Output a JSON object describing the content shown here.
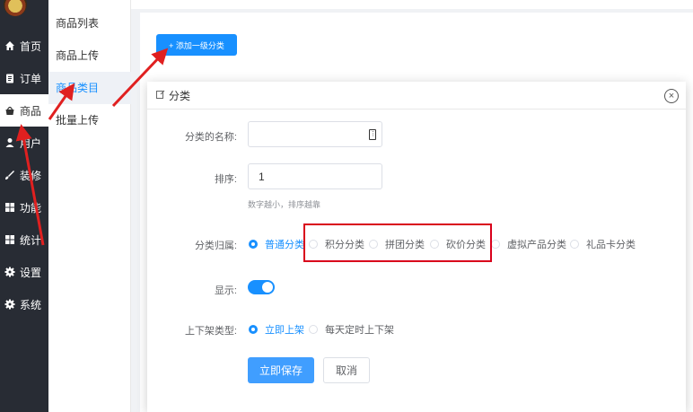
{
  "sidebar": {
    "items": [
      {
        "label": "首页",
        "icon": "home-icon"
      },
      {
        "label": "订单",
        "icon": "clipboard-icon"
      },
      {
        "label": "商品",
        "icon": "bag-icon",
        "active": true
      },
      {
        "label": "用户",
        "icon": "user-icon"
      },
      {
        "label": "装修",
        "icon": "brush-icon"
      },
      {
        "label": "功能",
        "icon": "grid-icon"
      },
      {
        "label": "统计",
        "icon": "chart-grid-icon"
      },
      {
        "label": "设置",
        "icon": "gear-icon"
      },
      {
        "label": "系统",
        "icon": "gear-icon"
      }
    ]
  },
  "subnav": {
    "items": [
      {
        "label": "商品列表"
      },
      {
        "label": "商品上传"
      },
      {
        "label": "商品类目",
        "active": true
      },
      {
        "label": "批量上传"
      }
    ]
  },
  "main": {
    "add_button": "+ 添加一级分类"
  },
  "modal": {
    "title": "分类",
    "fields": {
      "name_label": "分类的名称:",
      "name_value": "",
      "sort_label": "排序:",
      "sort_value": "1",
      "sort_hint": "数字越小，排序越靠",
      "type_label": "分类归属:",
      "type_options": [
        "普通分类",
        "积分分类",
        "拼团分类",
        "砍价分类",
        "虚拟产品分类",
        "礼品卡分类"
      ],
      "type_selected": "普通分类",
      "show_label": "显示:",
      "show_enabled": true,
      "shelf_label": "上下架类型:",
      "shelf_options": [
        "立即上架",
        "每天定时上下架"
      ],
      "shelf_selected": "立即上架"
    },
    "save_button": "立即保存",
    "cancel_button": "取消"
  },
  "colors": {
    "sidebar_bg": "#282c34",
    "primary": "#1890ff",
    "annotation": "#d9001b"
  }
}
